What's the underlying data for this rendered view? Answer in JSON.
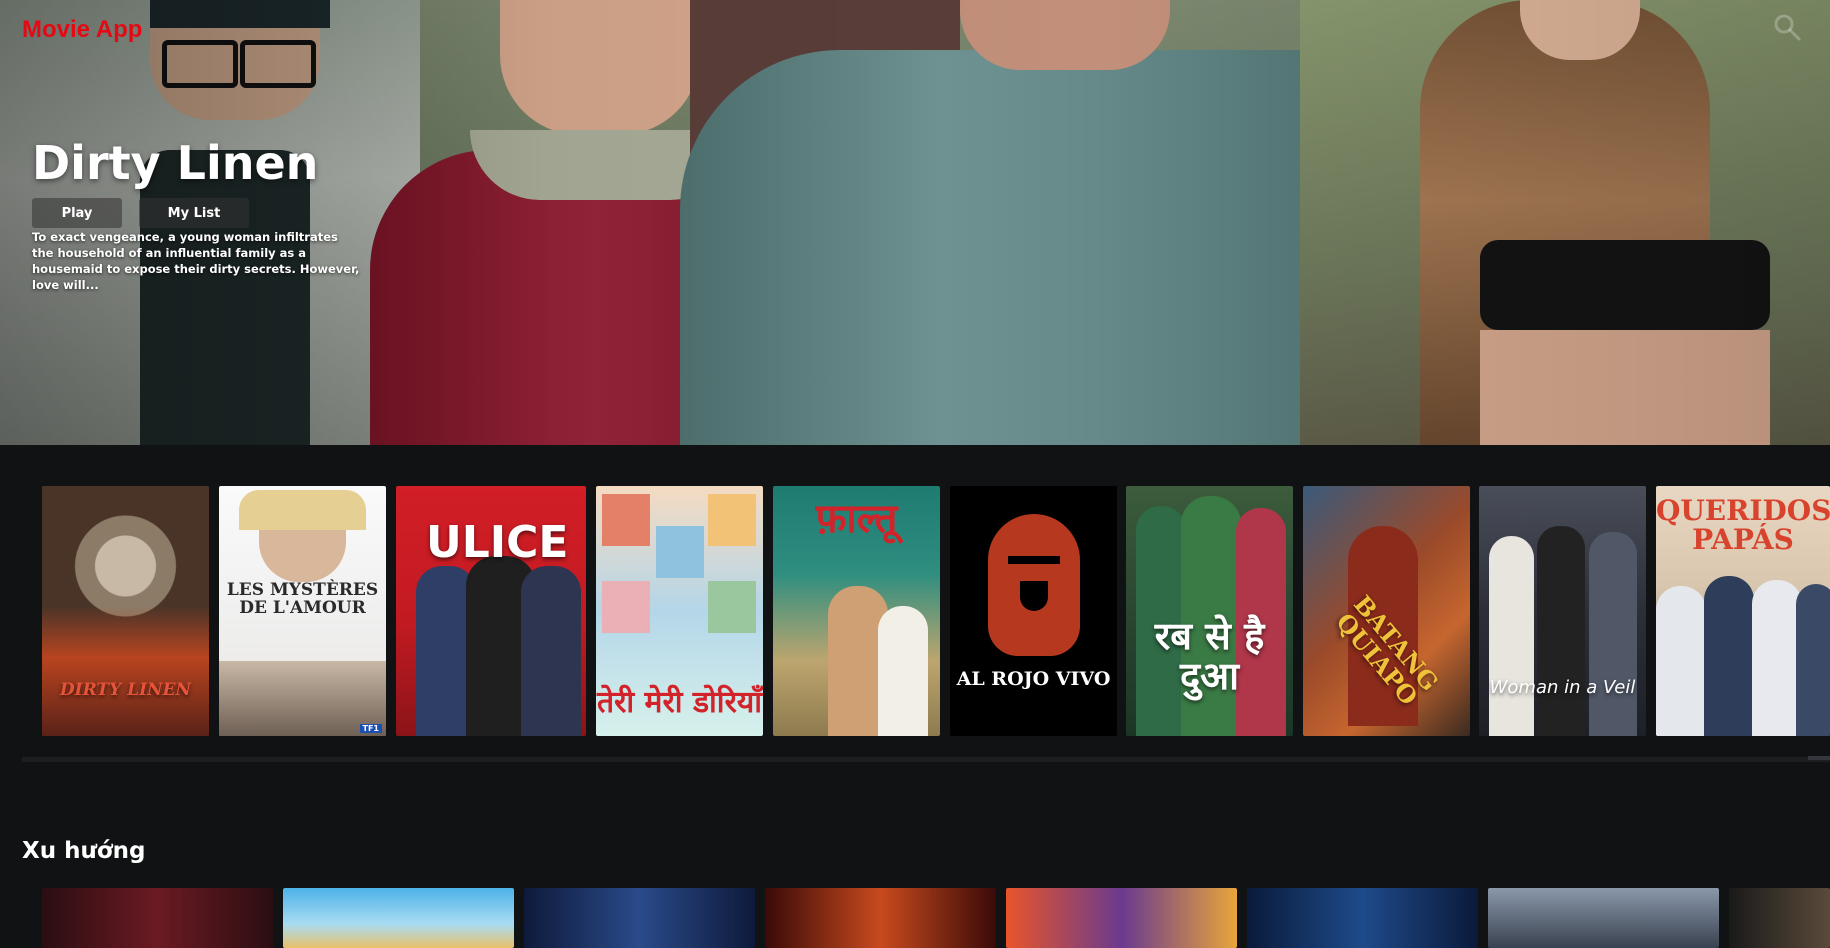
{
  "app": {
    "logo_text": "Movie App",
    "accent_color": "#e50914",
    "search_icon": "search-icon"
  },
  "hero": {
    "title": "Dirty Linen",
    "play_label": "Play",
    "mylist_label": "My List",
    "description": "To exact vengeance, a young woman infiltrates the household of an influential family as a housemaid to expose their dirty secrets. However, love will..."
  },
  "originals": {
    "posters": [
      {
        "title": "DIRTY LINEN"
      },
      {
        "title": "LES MYSTÈRES DE L'AMOUR",
        "badge": "TF1"
      },
      {
        "title": "ULICE"
      },
      {
        "title": "तेरी मेरी डोरियाँ"
      },
      {
        "title": "फ़ाल्तू"
      },
      {
        "title": "AL ROJO VIVO"
      },
      {
        "title": "रब से है दुआ"
      },
      {
        "title": "BATANG QUIAPO"
      },
      {
        "title": "Woman in a Veil"
      },
      {
        "title": "QUERIDOS PAPÁS"
      }
    ]
  },
  "trending": {
    "title": "Xu hướng"
  }
}
